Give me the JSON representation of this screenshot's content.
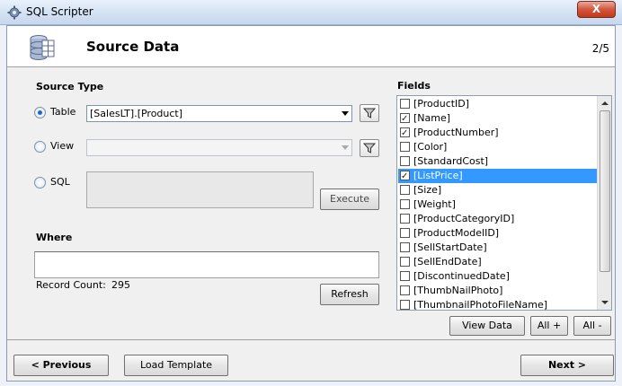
{
  "window": {
    "title": "SQL Scripter",
    "close_label": "X"
  },
  "header": {
    "title": "Source Data",
    "step": "2/5"
  },
  "source_type": {
    "label": "Source Type",
    "table_label": "Table",
    "table_value": "[SalesLT].[Product]",
    "view_label": "View",
    "view_value": "",
    "sql_label": "SQL",
    "execute_label": "Execute",
    "selected": "Table"
  },
  "where": {
    "label": "Where",
    "value": "",
    "record_count_label": "Record Count:",
    "record_count": "295",
    "refresh_label": "Refresh"
  },
  "fields": {
    "label": "Fields",
    "items": [
      {
        "name": "[ProductID]",
        "checked": false
      },
      {
        "name": "[Name]",
        "checked": true
      },
      {
        "name": "[ProductNumber]",
        "checked": true
      },
      {
        "name": "[Color]",
        "checked": false
      },
      {
        "name": "[StandardCost]",
        "checked": false
      },
      {
        "name": "[ListPrice]",
        "checked": true,
        "selected": true
      },
      {
        "name": "[Size]",
        "checked": false
      },
      {
        "name": "[Weight]",
        "checked": false
      },
      {
        "name": "[ProductCategoryID]",
        "checked": false
      },
      {
        "name": "[ProductModelID]",
        "checked": false
      },
      {
        "name": "[SellStartDate]",
        "checked": false
      },
      {
        "name": "[SellEndDate]",
        "checked": false
      },
      {
        "name": "[DiscontinuedDate]",
        "checked": false
      },
      {
        "name": "[ThumbNailPhoto]",
        "checked": false
      },
      {
        "name": "[ThumbnailPhotoFileName]",
        "checked": false
      }
    ],
    "view_data_label": "View Data",
    "all_plus_label": "All +",
    "all_minus_label": "All -"
  },
  "footer": {
    "previous_label": "< Previous",
    "load_template_label": "Load Template",
    "next_label": "Next >"
  },
  "colors": {
    "selection": "#3399ff",
    "radio_dot": "#2166c9"
  }
}
